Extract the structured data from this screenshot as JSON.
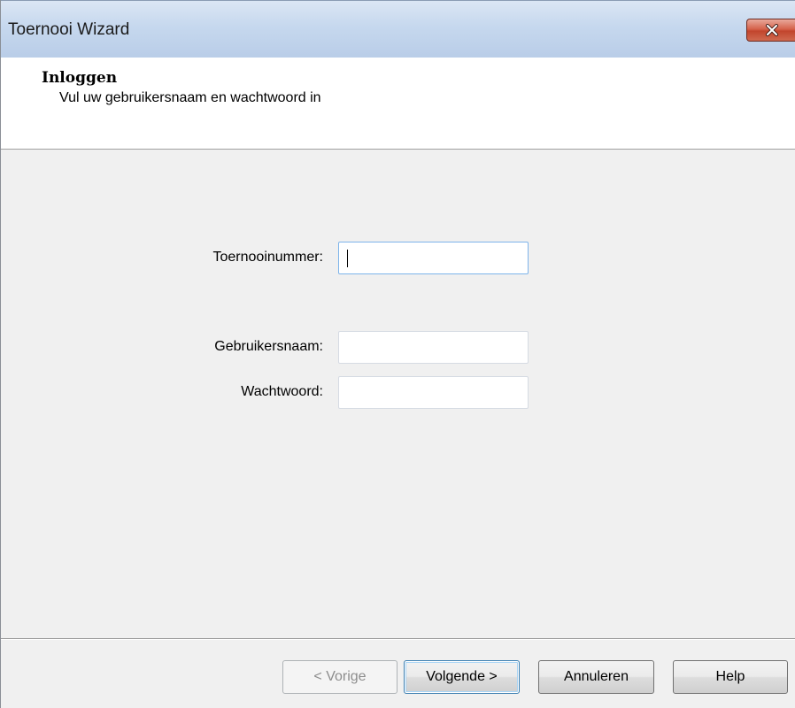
{
  "window": {
    "title": "Toernooi Wizard",
    "close_icon": "close-x-icon"
  },
  "header": {
    "title": "Inloggen",
    "subtitle": "Vul uw gebruikersnaam en wachtwoord in"
  },
  "form": {
    "tournament_number": {
      "label": "Toernooinummer:",
      "value": ""
    },
    "username": {
      "label": "Gebruikersnaam:",
      "value": ""
    },
    "password": {
      "label": "Wachtwoord:",
      "value": ""
    }
  },
  "buttons": {
    "back": "< Vorige",
    "next": "Volgende >",
    "cancel": "Annuleren",
    "help": "Help"
  },
  "colors": {
    "titlebar": "#c6d8ee",
    "close_button": "#c2452d",
    "content_bg": "#f0f0f0",
    "focus_border": "#7eb4ea"
  }
}
